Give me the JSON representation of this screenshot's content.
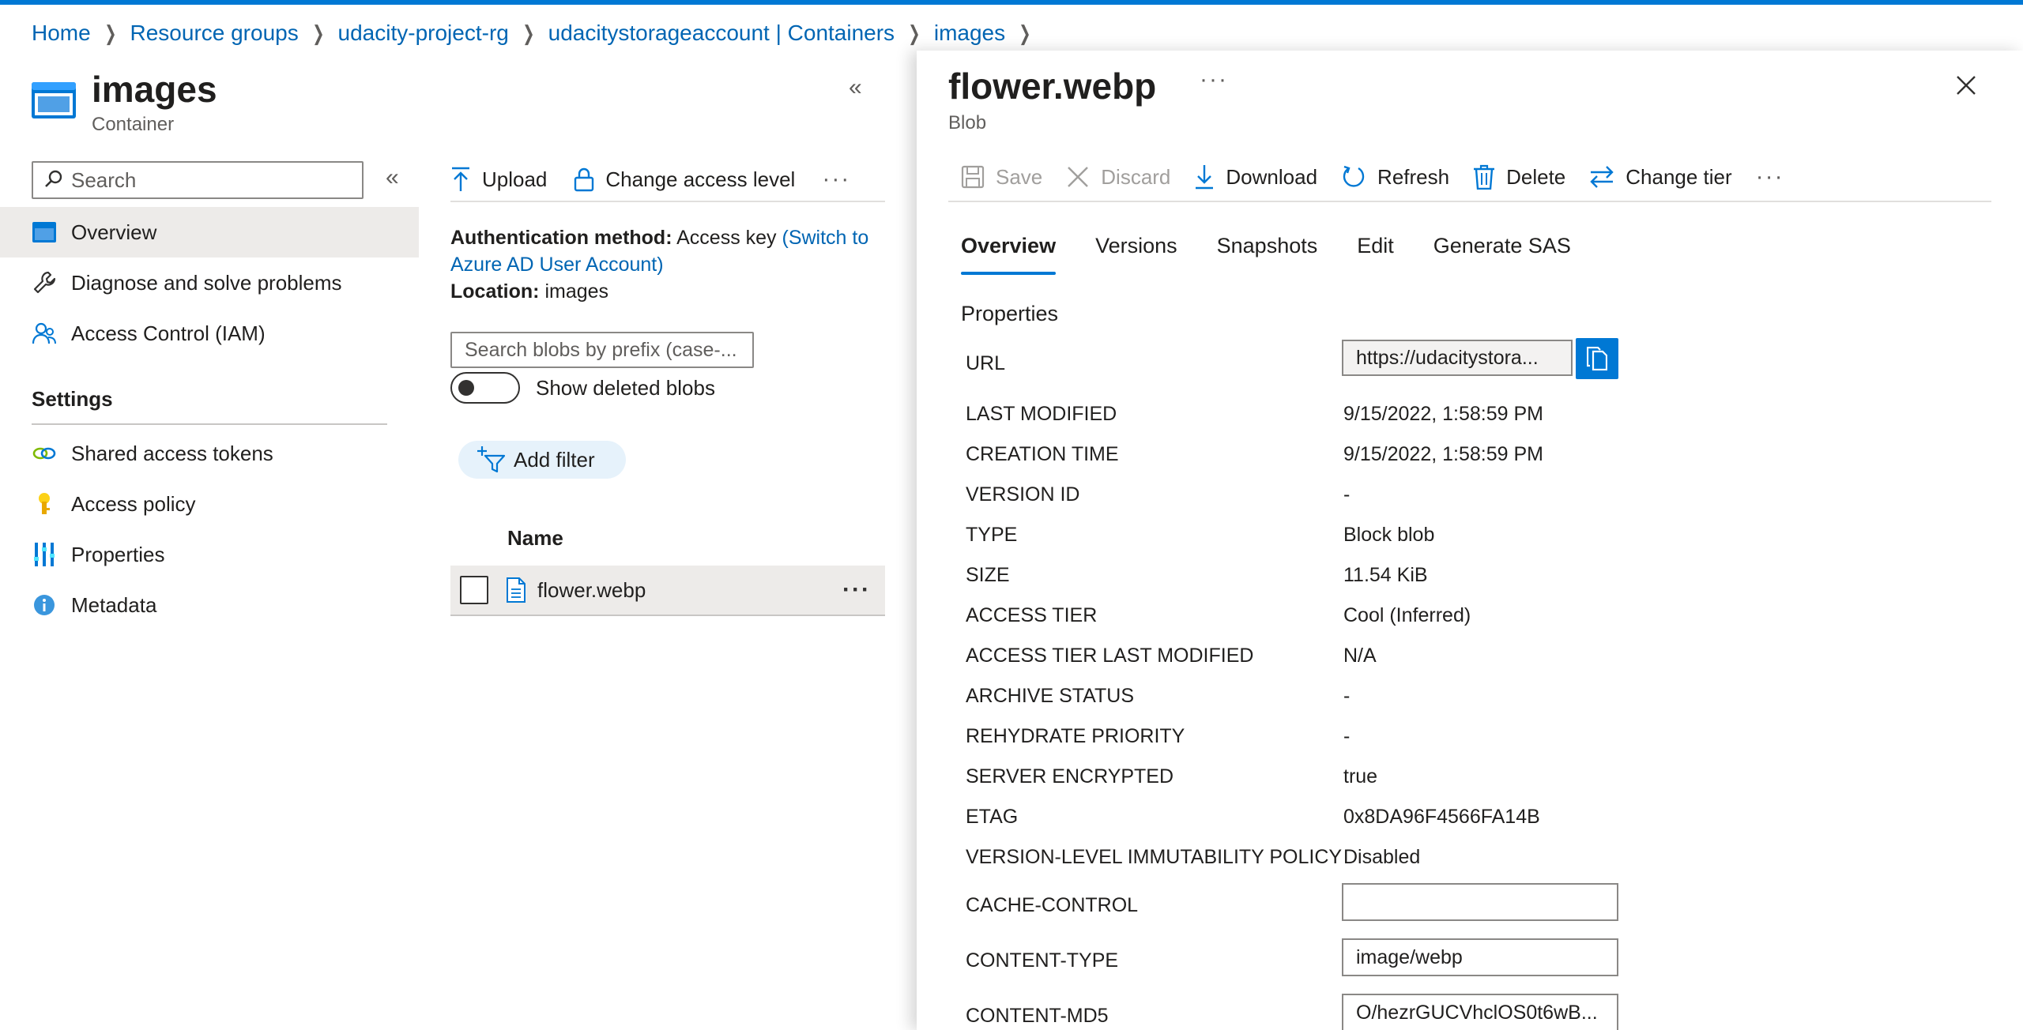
{
  "breadcrumb": [
    "Home",
    "Resource groups",
    "udacity-project-rg",
    "udacitystorageaccount | Containers",
    "images"
  ],
  "container": {
    "title": "images",
    "subtitle": "Container"
  },
  "menu": {
    "search_placeholder": "Search",
    "items": [
      {
        "label": "Overview",
        "icon": "overview-icon"
      },
      {
        "label": "Diagnose and solve problems",
        "icon": "wrench-icon"
      },
      {
        "label": "Access Control (IAM)",
        "icon": "people-icon"
      }
    ],
    "settings_label": "Settings",
    "settings_items": [
      {
        "label": "Shared access tokens",
        "icon": "link-icon"
      },
      {
        "label": "Access policy",
        "icon": "key-icon"
      },
      {
        "label": "Properties",
        "icon": "properties-icon"
      },
      {
        "label": "Metadata",
        "icon": "info-icon"
      }
    ]
  },
  "toolbar": {
    "upload": "Upload",
    "change_access": "Change access level",
    "more": "···"
  },
  "auth": {
    "method_label": "Authentication method:",
    "method_value": "Access key",
    "switch_link": "(Switch to Azure AD User Account)",
    "location_label": "Location:",
    "location_value": "images"
  },
  "blob_search_placeholder": "Search blobs by prefix (case-...",
  "show_deleted_label": "Show deleted blobs",
  "add_filter_label": "Add filter",
  "list": {
    "name_header": "Name",
    "rows": [
      {
        "name": "flower.webp"
      }
    ]
  },
  "blob_panel": {
    "title": "flower.webp",
    "subtitle": "Blob",
    "toolbar": {
      "save": "Save",
      "discard": "Discard",
      "download": "Download",
      "refresh": "Refresh",
      "delete": "Delete",
      "change_tier": "Change tier"
    },
    "tabs": [
      "Overview",
      "Versions",
      "Snapshots",
      "Edit",
      "Generate SAS"
    ],
    "properties_heading": "Properties",
    "url_label": "URL",
    "url_value": "https://udacitystora...",
    "properties": [
      {
        "label": "LAST MODIFIED",
        "value": "9/15/2022, 1:58:59 PM"
      },
      {
        "label": "CREATION TIME",
        "value": "9/15/2022, 1:58:59 PM"
      },
      {
        "label": "VERSION ID",
        "value": "-"
      },
      {
        "label": "TYPE",
        "value": "Block blob"
      },
      {
        "label": "SIZE",
        "value": "11.54 KiB"
      },
      {
        "label": "ACCESS TIER",
        "value": "Cool (Inferred)"
      },
      {
        "label": "ACCESS TIER LAST MODIFIED",
        "value": "N/A"
      },
      {
        "label": "ARCHIVE STATUS",
        "value": "-"
      },
      {
        "label": "REHYDRATE PRIORITY",
        "value": "-"
      },
      {
        "label": "SERVER ENCRYPTED",
        "value": "true"
      },
      {
        "label": "ETAG",
        "value": "0x8DA96F4566FA14B"
      },
      {
        "label": "VERSION-LEVEL IMMUTABILITY POLICY",
        "value": "Disabled"
      }
    ],
    "editable": [
      {
        "label": "CACHE-CONTROL",
        "value": ""
      },
      {
        "label": "CONTENT-TYPE",
        "value": "image/webp"
      },
      {
        "label": "CONTENT-MD5",
        "value": "O/hezrGUCVhclOS0t6wB..."
      }
    ]
  },
  "colors": {
    "accent": "#0078d4",
    "link": "#0065b3",
    "selected_bg": "#edebe9"
  }
}
